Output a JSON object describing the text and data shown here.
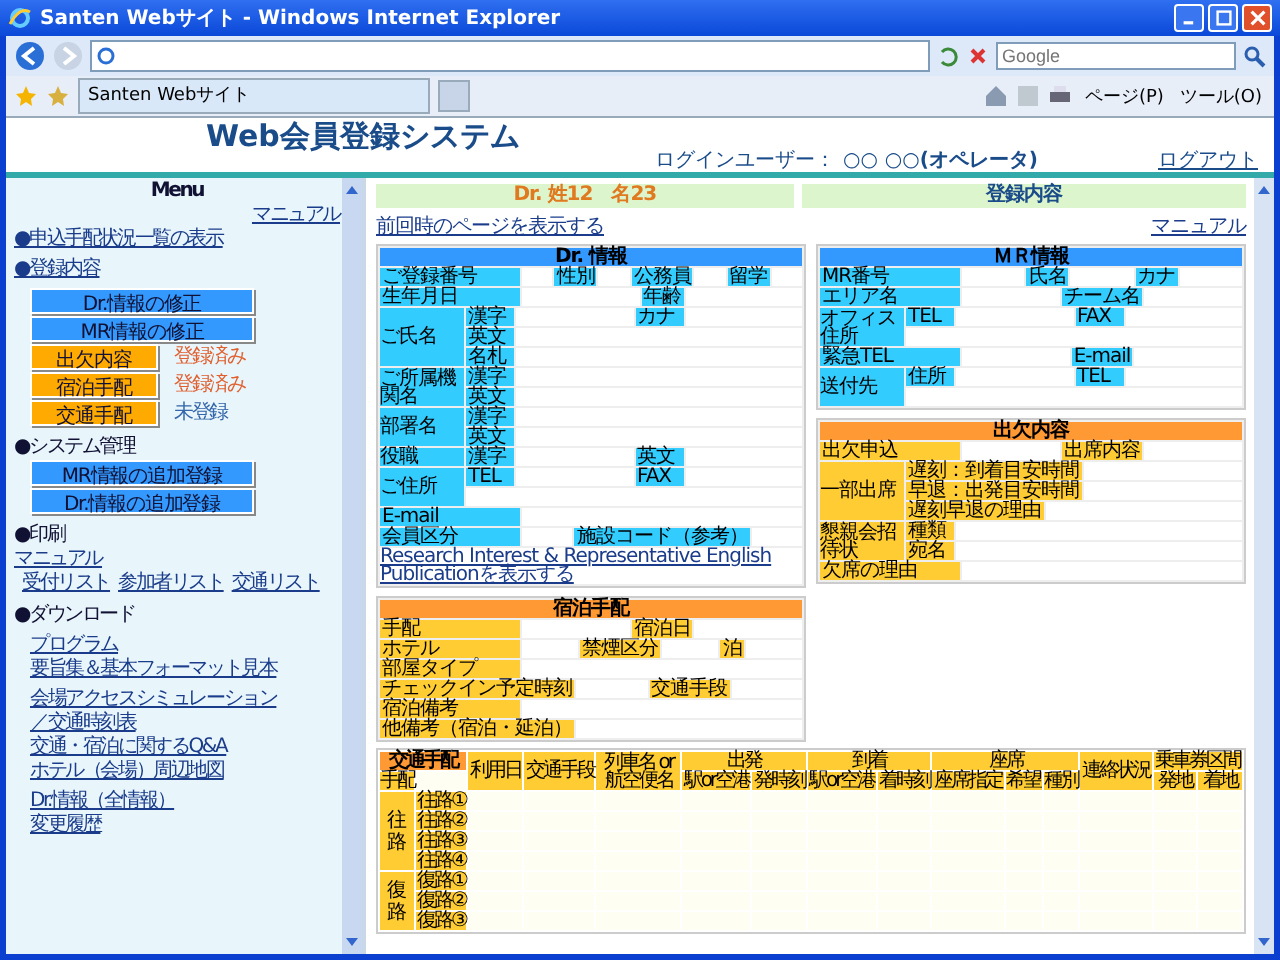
{
  "window": {
    "title": "Santen Webサイト - Windows Internet Explorer"
  },
  "browser": {
    "search_placeholder": "Google",
    "tab": "Santen Webサイト",
    "tools": [
      "ページ(P)",
      "ツール(O)"
    ]
  },
  "header": {
    "title": "Web会員登録システム",
    "login_label": "ログインユーザー：",
    "login_user": "○○ ○○(オペレータ)",
    "logout": "ログアウト"
  },
  "sidebar": {
    "title": "Menu",
    "items": [
      {
        "kind": "manual",
        "text": "マニュアル"
      },
      {
        "kind": "section_link",
        "text": "●申込手配状況一覧の表示"
      },
      {
        "kind": "section_link",
        "text": "●登録内容"
      },
      {
        "kind": "button",
        "color": "#3399ff",
        "text": "Dr.情報の修正"
      },
      {
        "kind": "button",
        "color": "#3399ff",
        "text": "MR情報の修正"
      },
      {
        "kind": "button",
        "color": "#ffaa00",
        "text": "出欠内容",
        "status": "登録済み",
        "registered": true
      },
      {
        "kind": "button",
        "color": "#ffaa00",
        "text": "宿泊手配",
        "status": "登録済み",
        "registered": true
      },
      {
        "kind": "button",
        "color": "#ffaa00",
        "text": "交通手配",
        "status": "未登録",
        "registered": false
      },
      {
        "kind": "heading",
        "text": "●システム管理"
      },
      {
        "kind": "button",
        "color": "#3399ff",
        "text": "MR情報の追加登録"
      },
      {
        "kind": "button",
        "color": "#3399ff",
        "text": "Dr.情報の追加登録"
      },
      {
        "kind": "heading",
        "text": "●印刷"
      },
      {
        "kind": "top_link",
        "text": "マニュアル"
      },
      {
        "kind": "link_row",
        "links": [
          "受付リスト",
          "参加者リスト",
          "交通リスト"
        ]
      },
      {
        "kind": "heading",
        "text": "●ダウンロード"
      },
      {
        "kind": "link_group",
        "links": [
          "プログラム",
          "要旨集＆基本フォーマット見本"
        ]
      },
      {
        "kind": "link_group",
        "links": [
          "会場アクセスシミュレーション",
          "／交通時刻表",
          "交通・宿泊に関するQ&A",
          "ホテル（会場）周辺地図"
        ]
      },
      {
        "kind": "link_group",
        "links": [
          "Dr.情報（全情報）",
          "変更履歴"
        ]
      }
    ]
  },
  "main": {
    "doctor_name": "Dr. 姓12　名23",
    "section_title": "登録内容",
    "prev_link": "前回時のページを表示する",
    "manual_link": "マニュアル",
    "left_column": [
      {
        "title": "Dr. 情報",
        "kind": "info",
        "rows": [
          {
            "labels": [
              "ご登録番号",
              "性別",
              "公務員",
              "留学"
            ]
          },
          {
            "labels": [
              "生年月日",
              "年齢"
            ]
          },
          {
            "label": "ご氏名",
            "lines": [
              [
                "漢字",
                "カナ"
              ],
              [
                "英文"
              ],
              [
                "名札"
              ]
            ]
          },
          {
            "label": "ご所属機関名",
            "lines": [
              [
                "漢字"
              ],
              [
                "英文"
              ]
            ]
          },
          {
            "label": "部署名",
            "lines": [
              [
                "漢字"
              ],
              [
                "英文"
              ]
            ]
          },
          {
            "label": "役職",
            "lines": [
              [
                "漢字",
                "英文"
              ]
            ]
          },
          {
            "label": "ご住所",
            "lines": [
              [
                "TEL",
                "FAX"
              ]
            ],
            "blank_line": true
          },
          {
            "labels": [
              "E-mail"
            ]
          },
          {
            "labels": [
              "会員区分",
              "施設コード（参考）"
            ]
          }
        ],
        "footer_link": "Research Interest & Representative English Publicationを表示する"
      },
      {
        "title": "宿泊手配",
        "kind": "arrangement",
        "rows": [
          {
            "labels": [
              "手配",
              "宿泊日"
            ]
          },
          {
            "labels": [
              "ホテル",
              "禁煙区分",
              "泊"
            ]
          },
          {
            "labels": [
              "部屋タイプ"
            ]
          },
          {
            "labels": [
              "チェックイン予定時刻",
              "交通手段"
            ]
          },
          {
            "labels": [
              "宿泊備考"
            ]
          },
          {
            "labels": [
              "他備考（宿泊・延泊）"
            ]
          }
        ]
      }
    ],
    "right_column": [
      {
        "title": "ＭＲ情報",
        "kind": "info",
        "rows": [
          {
            "labels": [
              "MR番号",
              "氏名",
              "カナ"
            ]
          },
          {
            "labels": [
              "エリア名",
              "チーム名"
            ]
          },
          {
            "label": "オフィス住所",
            "lines": [
              [
                "TEL",
                "FAX"
              ]
            ],
            "blank_line": true
          },
          {
            "labels": [
              "緊急TEL",
              "E-mail"
            ]
          },
          {
            "label": "送付先",
            "lines": [
              [
                "住所",
                "TEL"
              ]
            ],
            "blank_line": true
          }
        ]
      },
      {
        "title": "出欠内容",
        "kind": "arrangement",
        "rows": [
          {
            "labels": [
              "出欠申込",
              "出席内容"
            ]
          },
          {
            "label": "一部出席",
            "lines": [
              [
                "遅刻：到着目安時間"
              ],
              [
                "早退：出発目安時間"
              ],
              [
                "遅刻早退の理由"
              ]
            ]
          },
          {
            "label": "懇親会招待状",
            "lines": [
              [
                "種類"
              ],
              [
                "宛名"
              ]
            ]
          },
          {
            "labels": [
              "欠席の理由"
            ]
          }
        ]
      }
    ],
    "transport": {
      "title": "交通手配",
      "arrange_label": "手配",
      "columns": [
        {
          "label": "利用日"
        },
        {
          "label": "交通手段"
        },
        {
          "label": "列車名 or 航空便名"
        },
        {
          "label": "出発",
          "children": [
            "駅or空港",
            "発時刻"
          ]
        },
        {
          "label": "到着",
          "children": [
            "駅or空港",
            "着時刻"
          ]
        },
        {
          "label": "座席",
          "children": [
            "座席指定",
            "希望",
            "種別"
          ]
        },
        {
          "label": "連絡状況"
        },
        {
          "label": "乗車券区間",
          "children": [
            "発地",
            "着地"
          ]
        }
      ],
      "groups": [
        {
          "label": "往路",
          "rows": [
            "往路①",
            "往路②",
            "往路③",
            "往路④"
          ]
        },
        {
          "label": "復路",
          "rows": [
            "復路①",
            "復路②",
            "復路③"
          ]
        }
      ]
    }
  }
}
